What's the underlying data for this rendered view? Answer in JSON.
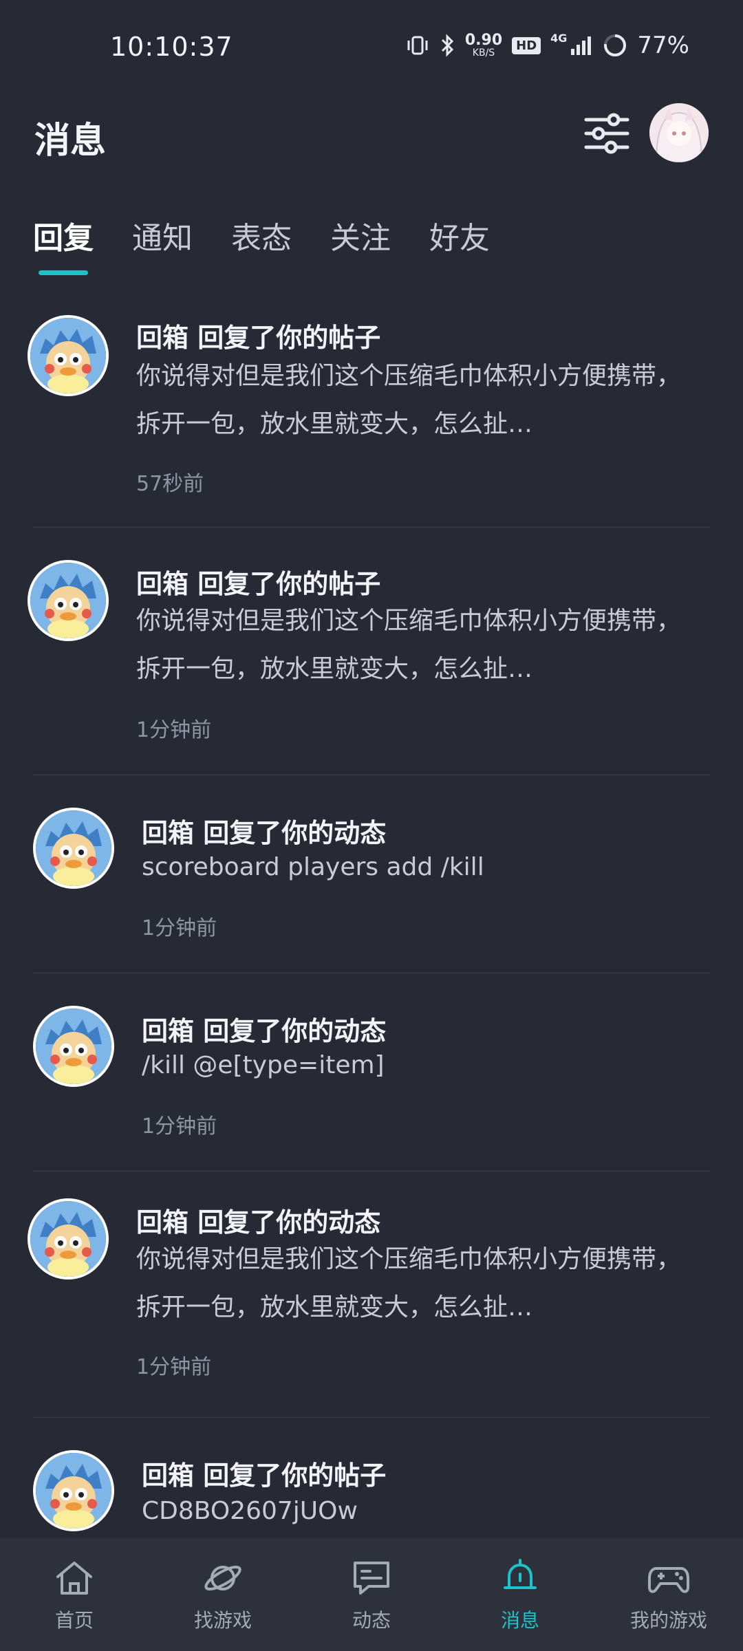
{
  "status_bar": {
    "time": "10:10:37",
    "speed_value": "0.90",
    "speed_unit": "KB/S",
    "hd": "HD",
    "network": "4G",
    "battery": "77%"
  },
  "header": {
    "title": "消息"
  },
  "tabs": [
    {
      "label": "回复",
      "active": true
    },
    {
      "label": "通知",
      "active": false
    },
    {
      "label": "表态",
      "active": false
    },
    {
      "label": "关注",
      "active": false
    },
    {
      "label": "好友",
      "active": false
    }
  ],
  "messages": [
    {
      "title": "回箱 回复了你的帖子",
      "body": "你说得对但是我们这个压缩毛巾体积小方便携带，拆开一包，放水里就变大，怎么扯…",
      "time": "57秒前"
    },
    {
      "title": "回箱 回复了你的帖子",
      "body": "你说得对但是我们这个压缩毛巾体积小方便携带，拆开一包，放水里就变大，怎么扯…",
      "time": "1分钟前"
    },
    {
      "title": "回箱 回复了你的动态",
      "body": "scoreboard players add /kill",
      "time": "1分钟前"
    },
    {
      "title": "回箱 回复了你的动态",
      "body": "/kill @e[type=item]",
      "time": "1分钟前"
    },
    {
      "title": "回箱 回复了你的动态",
      "body": "你说得对但是我们这个压缩毛巾体积小方便携带，拆开一包，放水里就变大，怎么扯…",
      "time": "1分钟前"
    },
    {
      "title": "回箱 回复了你的帖子",
      "body": "CD8BO2607jUOw",
      "time": ""
    }
  ],
  "bottom_nav": [
    {
      "label": "首页",
      "icon": "home-icon",
      "active": false
    },
    {
      "label": "找游戏",
      "icon": "planet-icon",
      "active": false
    },
    {
      "label": "动态",
      "icon": "chat-icon",
      "active": false
    },
    {
      "label": "消息",
      "icon": "bell-icon",
      "active": true
    },
    {
      "label": "我的游戏",
      "icon": "gamepad-icon",
      "active": false
    }
  ],
  "colors": {
    "background": "#262a34",
    "accent": "#1ec2c8",
    "nav_background": "#2d313c"
  }
}
